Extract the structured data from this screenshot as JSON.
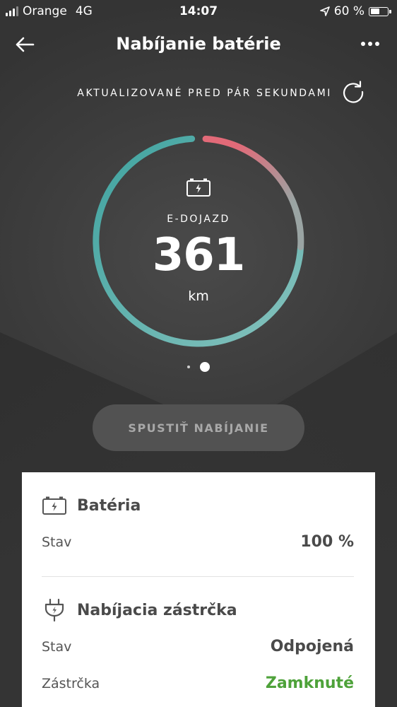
{
  "status_bar": {
    "carrier": "Orange",
    "network": "4G",
    "time": "14:07",
    "battery": "60 %",
    "battery_level": 0.6
  },
  "header": {
    "title": "Nabíjanie batérie"
  },
  "updated": {
    "text": "AKTUALIZOVANÉ PRED PÁR SEKUNDAMI"
  },
  "gauge": {
    "label": "E-DOJAZD",
    "value": "361",
    "unit": "km",
    "colors": {
      "start": "#3fa3a0",
      "end": "#e26a78"
    }
  },
  "pager": {
    "count": 2,
    "active": 1
  },
  "action": {
    "label": "SPUSTIŤ NABÍJANIE"
  },
  "battery_section": {
    "title": "Batéria",
    "rows": [
      {
        "label": "Stav",
        "value": "100 %"
      }
    ]
  },
  "plug_section": {
    "title": "Nabíjacia zástrčka",
    "rows": [
      {
        "label": "Stav",
        "value": "Odpojená"
      },
      {
        "label": "Zástrčka",
        "value": "Zamknuté",
        "color": "#4ea23a"
      }
    ]
  }
}
